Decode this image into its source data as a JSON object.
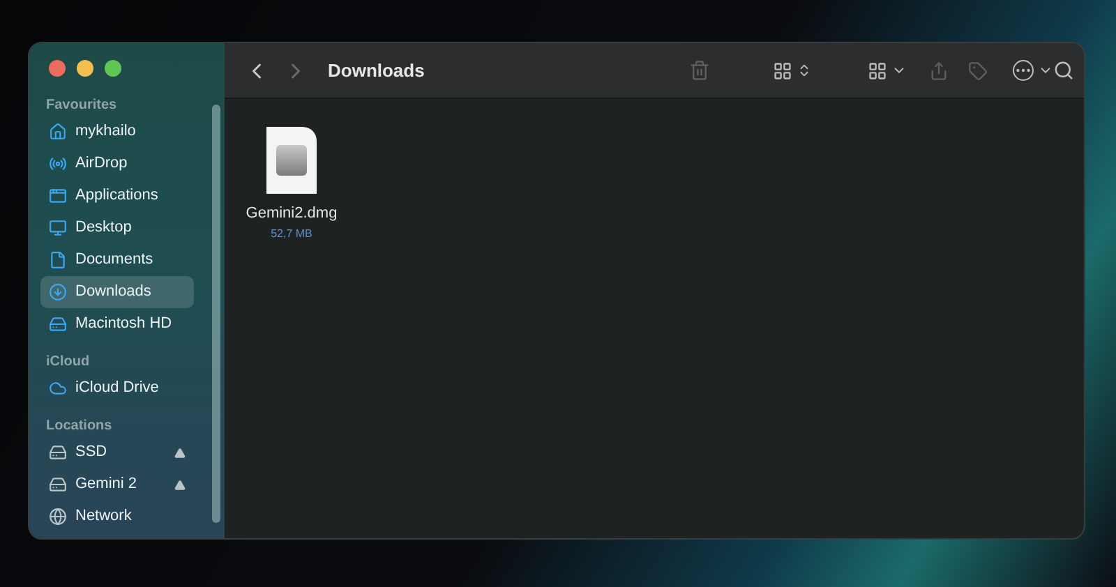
{
  "window": {
    "title": "Downloads"
  },
  "sidebar": {
    "sections": [
      {
        "heading": "Favourites",
        "items": [
          {
            "label": "mykhailo",
            "selected": false,
            "ejectable": false
          },
          {
            "label": "AirDrop",
            "selected": false,
            "ejectable": false
          },
          {
            "label": "Applications",
            "selected": false,
            "ejectable": false
          },
          {
            "label": "Desktop",
            "selected": false,
            "ejectable": false
          },
          {
            "label": "Documents",
            "selected": false,
            "ejectable": false
          },
          {
            "label": "Downloads",
            "selected": true,
            "ejectable": false
          },
          {
            "label": "Macintosh HD",
            "selected": false,
            "ejectable": false
          }
        ]
      },
      {
        "heading": "iCloud",
        "items": [
          {
            "label": "iCloud Drive",
            "selected": false,
            "ejectable": false
          }
        ]
      },
      {
        "heading": "Locations",
        "items": [
          {
            "label": "SSD",
            "selected": false,
            "ejectable": true
          },
          {
            "label": "Gemini 2",
            "selected": false,
            "ejectable": true
          },
          {
            "label": "Network",
            "selected": false,
            "ejectable": false
          }
        ]
      }
    ]
  },
  "files": [
    {
      "name": "Gemini2.dmg",
      "size": "52,7 MB"
    }
  ]
}
